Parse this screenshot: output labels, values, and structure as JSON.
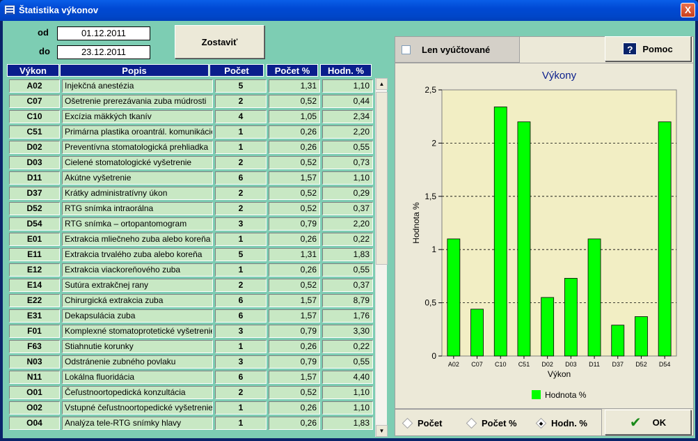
{
  "window": {
    "title": "Štatistika výkonov",
    "close_label": "X"
  },
  "filter": {
    "od_label": "od",
    "do_label": "do",
    "od_value": "01.12.2011",
    "do_value": "23.12.2011",
    "submit_label": "Zostaviť"
  },
  "table": {
    "columns": [
      "Výkon",
      "Popis",
      "Počet",
      "Počet %",
      "Hodn. %"
    ],
    "rows": [
      {
        "kod": "A02",
        "popis": "Injekčná anestézia",
        "pocet": "5",
        "pocet_pct": "1,31",
        "hodn_pct": "1,10"
      },
      {
        "kod": "C07",
        "popis": "Ošetrenie prerezávania zuba múdrosti",
        "pocet": "2",
        "pocet_pct": "0,52",
        "hodn_pct": "0,44"
      },
      {
        "kod": "C10",
        "popis": "Excízia mäkkých tkanív",
        "pocet": "4",
        "pocet_pct": "1,05",
        "hodn_pct": "2,34"
      },
      {
        "kod": "C51",
        "popis": "Primárna plastika oroantrál. komunikácie",
        "pocet": "1",
        "pocet_pct": "0,26",
        "hodn_pct": "2,20"
      },
      {
        "kod": "D02",
        "popis": "Preventívna stomatologická prehliadka",
        "pocet": "1",
        "pocet_pct": "0,26",
        "hodn_pct": "0,55"
      },
      {
        "kod": "D03",
        "popis": "Cielené stomatologické vyšetrenie",
        "pocet": "2",
        "pocet_pct": "0,52",
        "hodn_pct": "0,73"
      },
      {
        "kod": "D11",
        "popis": "Akútne vyšetrenie",
        "pocet": "6",
        "pocet_pct": "1,57",
        "hodn_pct": "1,10"
      },
      {
        "kod": "D37",
        "popis": "Krátky administratívny úkon",
        "pocet": "2",
        "pocet_pct": "0,52",
        "hodn_pct": "0,29"
      },
      {
        "kod": "D52",
        "popis": "RTG snímka intraorálna",
        "pocet": "2",
        "pocet_pct": "0,52",
        "hodn_pct": "0,37"
      },
      {
        "kod": "D54",
        "popis": "RTG snímka – ortopantomogram",
        "pocet": "3",
        "pocet_pct": "0,79",
        "hodn_pct": "2,20"
      },
      {
        "kod": "E01",
        "popis": "Extrakcia mliečneho zuba alebo koreňa",
        "pocet": "1",
        "pocet_pct": "0,26",
        "hodn_pct": "0,22"
      },
      {
        "kod": "E11",
        "popis": "Extrakcia trvalého zuba alebo koreňa",
        "pocet": "5",
        "pocet_pct": "1,31",
        "hodn_pct": "1,83"
      },
      {
        "kod": "E12",
        "popis": "Extrakcia viackoreňového zuba",
        "pocet": "1",
        "pocet_pct": "0,26",
        "hodn_pct": "0,55"
      },
      {
        "kod": "E14",
        "popis": "Sutúra extrakčnej rany",
        "pocet": "2",
        "pocet_pct": "0,52",
        "hodn_pct": "0,37"
      },
      {
        "kod": "E22",
        "popis": "Chirurgická extrakcia zuba",
        "pocet": "6",
        "pocet_pct": "1,57",
        "hodn_pct": "8,79"
      },
      {
        "kod": "E31",
        "popis": "Dekapsulácia zuba",
        "pocet": "6",
        "pocet_pct": "1,57",
        "hodn_pct": "1,76"
      },
      {
        "kod": "F01",
        "popis": "Komplexné stomatoprotetické vyšetrenie",
        "pocet": "3",
        "pocet_pct": "0,79",
        "hodn_pct": "3,30"
      },
      {
        "kod": "F63",
        "popis": "Stiahnutie korunky",
        "pocet": "1",
        "pocet_pct": "0,26",
        "hodn_pct": "0,22"
      },
      {
        "kod": "N03",
        "popis": "Odstránenie zubného povlaku",
        "pocet": "3",
        "pocet_pct": "0,79",
        "hodn_pct": "0,55"
      },
      {
        "kod": "N11",
        "popis": "Lokálna fluoridácia",
        "pocet": "6",
        "pocet_pct": "1,57",
        "hodn_pct": "4,40"
      },
      {
        "kod": "O01",
        "popis": "Čeľustnoortopedická konzultácia",
        "pocet": "2",
        "pocet_pct": "0,52",
        "hodn_pct": "1,10"
      },
      {
        "kod": "O02",
        "popis": "Vstupné čeľustnoortopedické vyšetrenie",
        "pocet": "1",
        "pocet_pct": "0,26",
        "hodn_pct": "1,10"
      },
      {
        "kod": "O04",
        "popis": "Analýza tele-RTG snímky hlavy",
        "pocet": "1",
        "pocet_pct": "0,26",
        "hodn_pct": "1,83"
      }
    ]
  },
  "options": {
    "len_vyuctovane_label": "Len vyúčtované",
    "len_vyuctovane_checked": false,
    "help_label": "Pomoc",
    "help_icon": "question-icon"
  },
  "chart_data": {
    "type": "bar",
    "title": "Výkony",
    "xlabel": "Výkon",
    "ylabel": "Hodnota %",
    "categories": [
      "A02",
      "C07",
      "C10",
      "C51",
      "D02",
      "D03",
      "D11",
      "D37",
      "D52",
      "D54"
    ],
    "series": [
      {
        "name": "Hodnota %",
        "values": [
          1.1,
          0.44,
          2.34,
          2.2,
          0.55,
          0.73,
          1.1,
          0.29,
          0.37,
          2.2
        ]
      }
    ],
    "yticks": [
      "0",
      "0,5",
      "1",
      "1,5",
      "2",
      "2,5"
    ],
    "ylim": [
      0,
      2.5
    ],
    "grid": true,
    "legend": "bottom",
    "bar_color": "#00ff00",
    "plot_bg": "#f2eec4"
  },
  "mode": {
    "options": [
      "Počet",
      "Počet %",
      "Hodn. %"
    ],
    "selected": "Hodn. %"
  },
  "footer": {
    "ok_label": "OK",
    "ok_icon": "checkmark-icon"
  }
}
